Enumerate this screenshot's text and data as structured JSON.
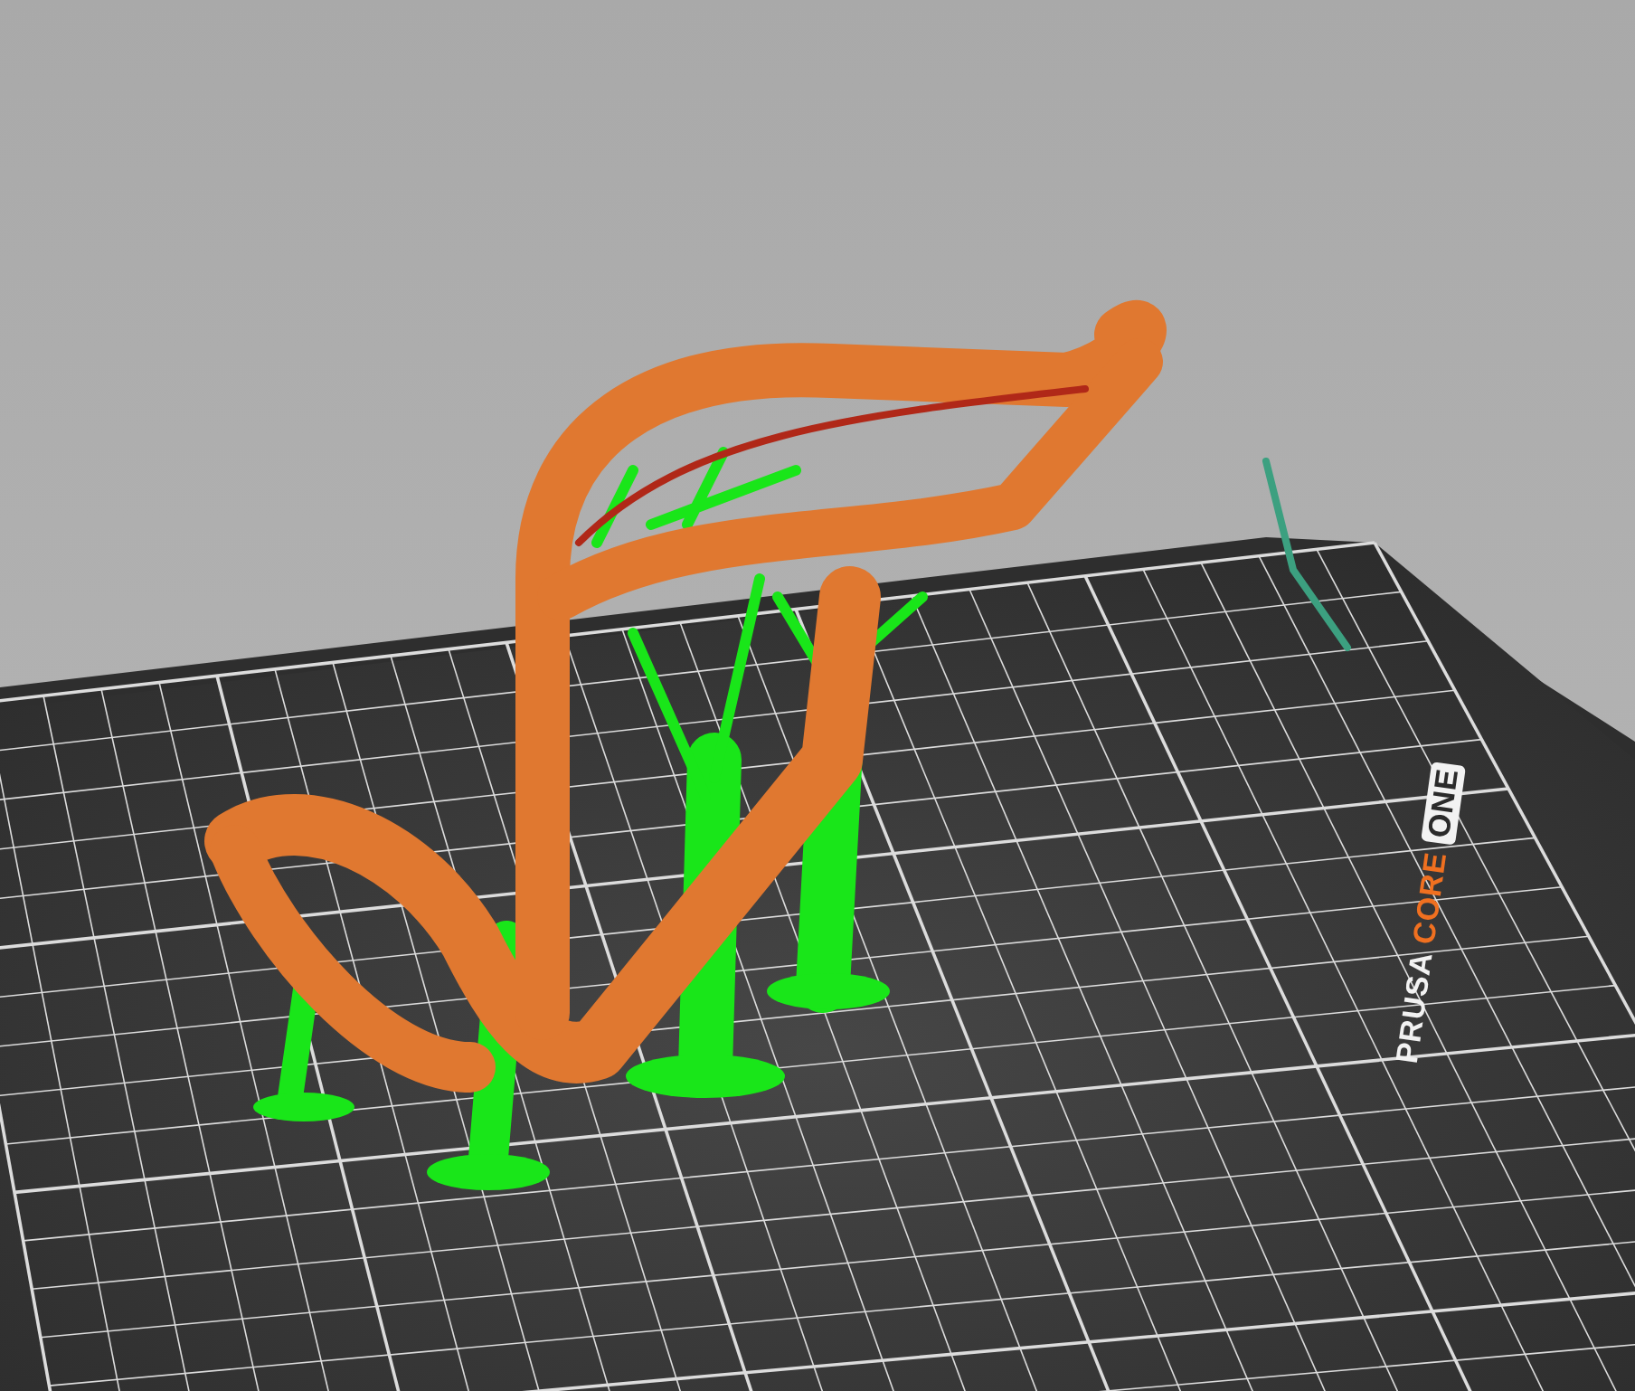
{
  "viewport": {
    "bed_logo": [
      {
        "text": "PRUSA",
        "kind": "plain"
      },
      {
        "text": "CORE",
        "kind": "accent"
      },
      {
        "text": "ONE",
        "kind": "boxed"
      }
    ]
  }
}
